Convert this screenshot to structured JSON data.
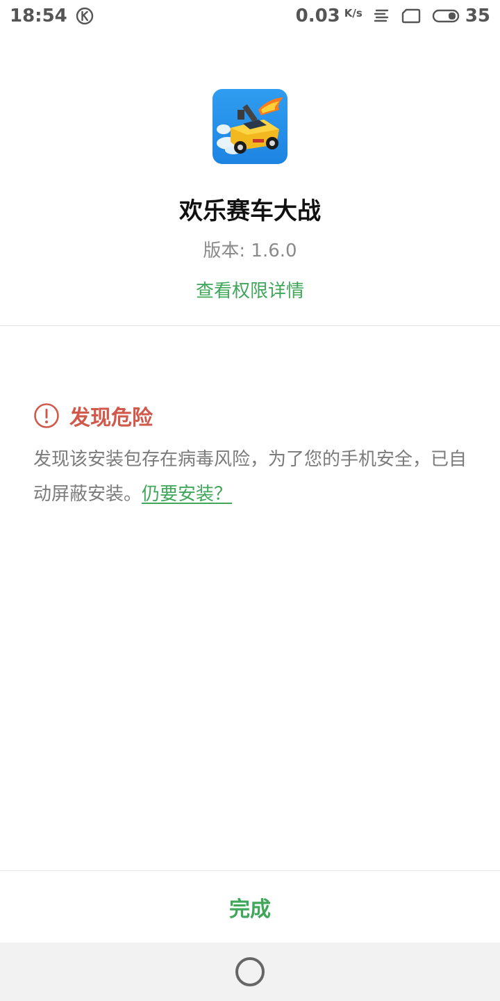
{
  "status_bar": {
    "time": "18:54",
    "speed": "0.03",
    "speed_unit": "K/s",
    "battery": "35"
  },
  "app": {
    "name": "欢乐赛车大战",
    "version_label": "版本: 1.6.0",
    "permissions_link": "查看权限详情",
    "icon": "racing-car-app-icon"
  },
  "warning": {
    "title": "发现危险",
    "message": "发现该安装包存在病毒风险，为了您的手机安全，已自动屏蔽安装。",
    "still_install_link": "仍要安装？",
    "color": "#d0594b"
  },
  "footer": {
    "done_label": "完成"
  },
  "colors": {
    "accent": "#3fa75a",
    "danger": "#d0594b"
  }
}
